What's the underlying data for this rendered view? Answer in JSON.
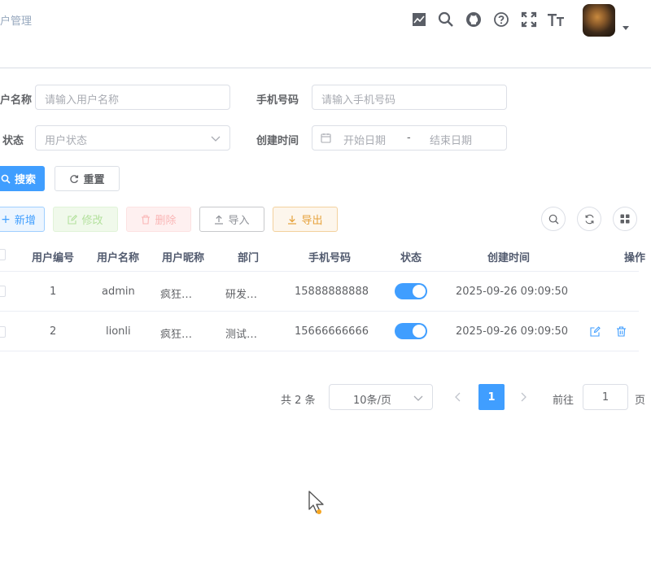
{
  "header": {
    "breadcrumb": "户管理",
    "icons": [
      "chart-icon",
      "search-icon",
      "github-icon",
      "help-icon",
      "fullscreen-icon",
      "font-size-icon"
    ]
  },
  "search": {
    "username_label": "户名称",
    "username_placeholder": "请输入用户名称",
    "phone_label": "手机号码",
    "phone_placeholder": "请输入手机号码",
    "status_label": "状态",
    "status_placeholder": "用户状态",
    "created_label": "创建时间",
    "date_start_placeholder": "开始日期",
    "date_sep": "-",
    "date_end_placeholder": "结束日期",
    "search_button": "搜索",
    "reset_button": "重置"
  },
  "toolbar": {
    "add": "新增",
    "edit": "修改",
    "delete": "删除",
    "import": "导入",
    "export": "导出"
  },
  "table": {
    "columns": [
      "用户编号",
      "用户名称",
      "用户昵称",
      "部门",
      "手机号码",
      "状态",
      "创建时间",
      "操作"
    ],
    "rows": [
      {
        "id": "1",
        "username": "admin",
        "nickname": "疯狂…",
        "dept": "研发…",
        "phone": "15888888888",
        "status_on": true,
        "created": "2025-09-26 09:09:50"
      },
      {
        "id": "2",
        "username": "lionli",
        "nickname": "疯狂…",
        "dept": "测试…",
        "phone": "15666666666",
        "status_on": true,
        "created": "2025-09-26 09:09:50"
      }
    ]
  },
  "pagination": {
    "total": "共 2 条",
    "page_size": "10条/页",
    "current_page": "1",
    "goto_prefix": "前往",
    "goto_value": "1",
    "goto_suffix": "页"
  },
  "colors": {
    "primary": "#409eff",
    "success": "#67c23a",
    "danger": "#f56c6c",
    "warning": "#e6a23c"
  }
}
